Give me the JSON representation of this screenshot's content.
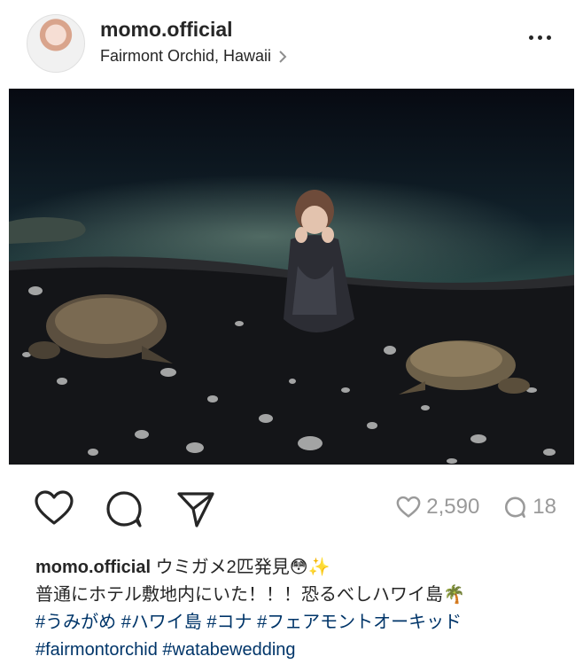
{
  "post": {
    "username": "momo.official",
    "location": "Fairmont Orchid, Hawaii",
    "likes": "2,590",
    "comments": "18"
  },
  "caption": {
    "username": "momo.official",
    "line1": "ウミガメ2匹発見😳✨",
    "line2": "普通にホテル敷地内にいた！！！恐るべしハワイ島🌴",
    "hashtags_line1": [
      "#うみがめ",
      "#ハワイ島",
      "#コナ",
      "#フェアモントオーキッド"
    ],
    "hashtags_line2": [
      "#fairmontorchid",
      "#watabewedding"
    ]
  },
  "colors": {
    "text": "#262626",
    "hashtag": "#003569",
    "muted": "#9a9a9a"
  },
  "icons": [
    "heart-icon",
    "comment-icon",
    "share-icon",
    "more-icon",
    "chevron-right-icon"
  ]
}
